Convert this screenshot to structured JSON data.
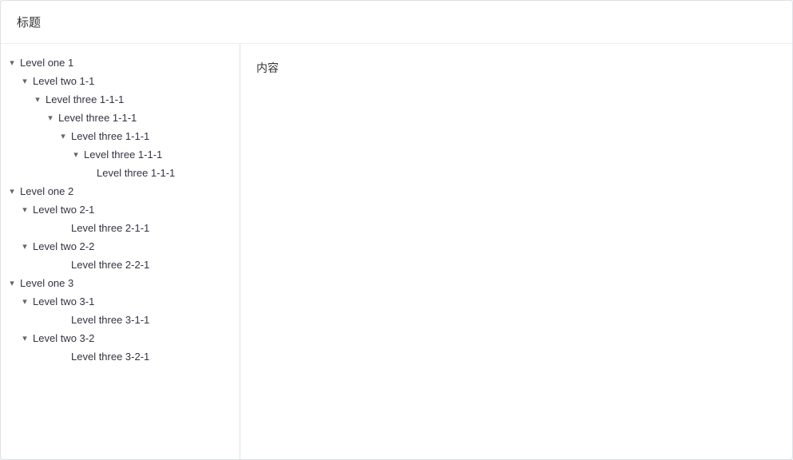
{
  "header": {
    "title": "标题"
  },
  "content": {
    "text": "内容"
  },
  "tree": [
    {
      "id": "level-one-1",
      "label": "Level one 1",
      "indent": "level-one",
      "hasArrow": true,
      "children": [
        {
          "id": "level-two-1-1",
          "label": "Level two 1-1",
          "indent": "level-two",
          "hasArrow": true,
          "children": [
            {
              "id": "level-three-1-1-1-a",
              "label": "Level three 1-1-1",
              "indent": "level-three-1",
              "hasArrow": true
            },
            {
              "id": "level-three-1-1-1-b",
              "label": "Level three 1-1-1",
              "indent": "level-three-2",
              "hasArrow": true
            },
            {
              "id": "level-three-1-1-1-c",
              "label": "Level three 1-1-1",
              "indent": "level-three-3",
              "hasArrow": true
            },
            {
              "id": "level-three-1-1-1-d",
              "label": "Level three 1-1-1",
              "indent": "level-three-4",
              "hasArrow": true
            },
            {
              "id": "level-three-1-1-1-e",
              "label": "Level three 1-1-1",
              "indent": "level-three-5",
              "hasArrow": false,
              "isLeaf": true
            }
          ]
        }
      ]
    },
    {
      "id": "level-one-2",
      "label": "Level one 2",
      "indent": "level-one",
      "hasArrow": true,
      "children": [
        {
          "id": "level-two-2-1",
          "label": "Level two 2-1",
          "indent": "level-two",
          "hasArrow": true,
          "children": [
            {
              "id": "level-three-2-1-1",
              "label": "Level three 2-1-1",
              "indent": "leaf2",
              "hasArrow": false,
              "isLeaf": true
            }
          ]
        },
        {
          "id": "level-two-2-2",
          "label": "Level two 2-2",
          "indent": "level-two",
          "hasArrow": true,
          "children": [
            {
              "id": "level-three-2-2-1",
              "label": "Level three 2-2-1",
              "indent": "leaf2",
              "hasArrow": false,
              "isLeaf": true
            }
          ]
        }
      ]
    },
    {
      "id": "level-one-3",
      "label": "Level one 3",
      "indent": "level-one",
      "hasArrow": true,
      "children": [
        {
          "id": "level-two-3-1",
          "label": "Level two 3-1",
          "indent": "level-two",
          "hasArrow": true,
          "children": [
            {
              "id": "level-three-3-1-1",
              "label": "Level three 3-1-1",
              "indent": "leaf2",
              "hasArrow": false,
              "isLeaf": true
            }
          ]
        },
        {
          "id": "level-two-3-2",
          "label": "Level two 3-2",
          "indent": "level-two",
          "hasArrow": true,
          "children": [
            {
              "id": "level-three-3-2-1",
              "label": "Level three 3-2-1",
              "indent": "leaf2",
              "hasArrow": false,
              "isLeaf": true
            }
          ]
        }
      ]
    }
  ]
}
